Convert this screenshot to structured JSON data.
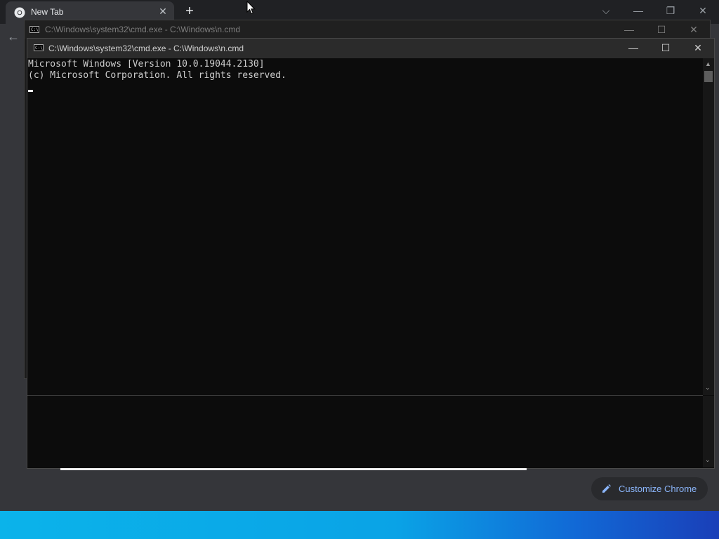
{
  "browser": {
    "tab_title": "New Tab",
    "tab_close_glyph": "✕",
    "new_tab_glyph": "+",
    "back_glyph": "←",
    "window_controls": [
      "⌵",
      "—",
      "❐",
      "✕"
    ]
  },
  "cmd_back": {
    "title": "C:\\Windows\\system32\\cmd.exe - C:\\Windows\\n.cmd",
    "controls": [
      "—",
      "☐",
      "✕"
    ]
  },
  "cmd_front": {
    "title": "C:\\Windows\\system32\\cmd.exe - C:\\Windows\\n.cmd",
    "controls": [
      "—",
      "☐",
      "✕"
    ],
    "console_lines": [
      "Microsoft Windows [Version 10.0.19044.2130]",
      "(c) Microsoft Corporation. All rights reserved."
    ],
    "scroll_up_glyph": "▲",
    "scroll_down_glyph": "⌄"
  },
  "customize_chrome": {
    "label": "Customize Chrome",
    "icon": "pencil-icon"
  },
  "colors": {
    "taskbar": "#0aa3e6",
    "accent_link": "#8ab4f8",
    "console_bg": "#0c0c0c"
  }
}
